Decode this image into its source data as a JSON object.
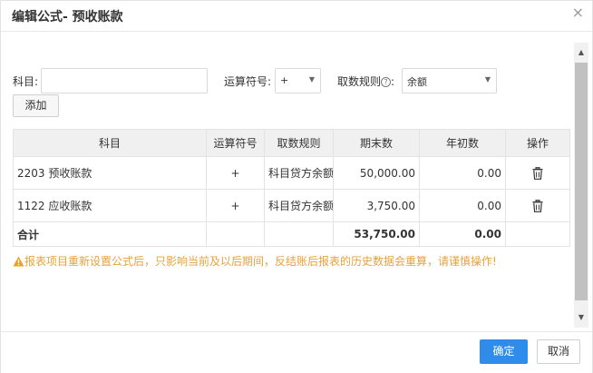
{
  "dialog": {
    "title": "编辑公式- 预收账款",
    "close_glyph": "×"
  },
  "form": {
    "subject_label": "科目:",
    "subject_value": "",
    "operator_label": "运算符号:",
    "operator_value": "+",
    "rule_label": "取数规则",
    "rule_colon": ":",
    "rule_value": "余额",
    "add_label": "添加"
  },
  "table": {
    "columns": [
      "科目",
      "运算符号",
      "取数规则",
      "期末数",
      "年初数",
      "操作"
    ],
    "rows": [
      {
        "subject": "2203 预收账款",
        "op": "+",
        "rule": "科目贷方余额",
        "end": "50,000.00",
        "begin": "0.00",
        "action_icon": "trash-icon"
      },
      {
        "subject": "1122 应收账款",
        "op": "+",
        "rule": "科目贷方余额",
        "end": "3,750.00",
        "begin": "0.00",
        "action_icon": "trash-icon"
      }
    ],
    "total": {
      "label": "合计",
      "end": "53,750.00",
      "begin": "0.00"
    }
  },
  "warning": "报表项目重新设置公式后，只影响当前及以后期间，反结账后报表的历史数据会重算，请谨慎操作!",
  "footer": {
    "ok_label": "确定",
    "cancel_label": "取消"
  },
  "colors": {
    "primary": "#2f8cea",
    "warning": "#e6a23c",
    "header_bg": "#f0f0f0"
  }
}
